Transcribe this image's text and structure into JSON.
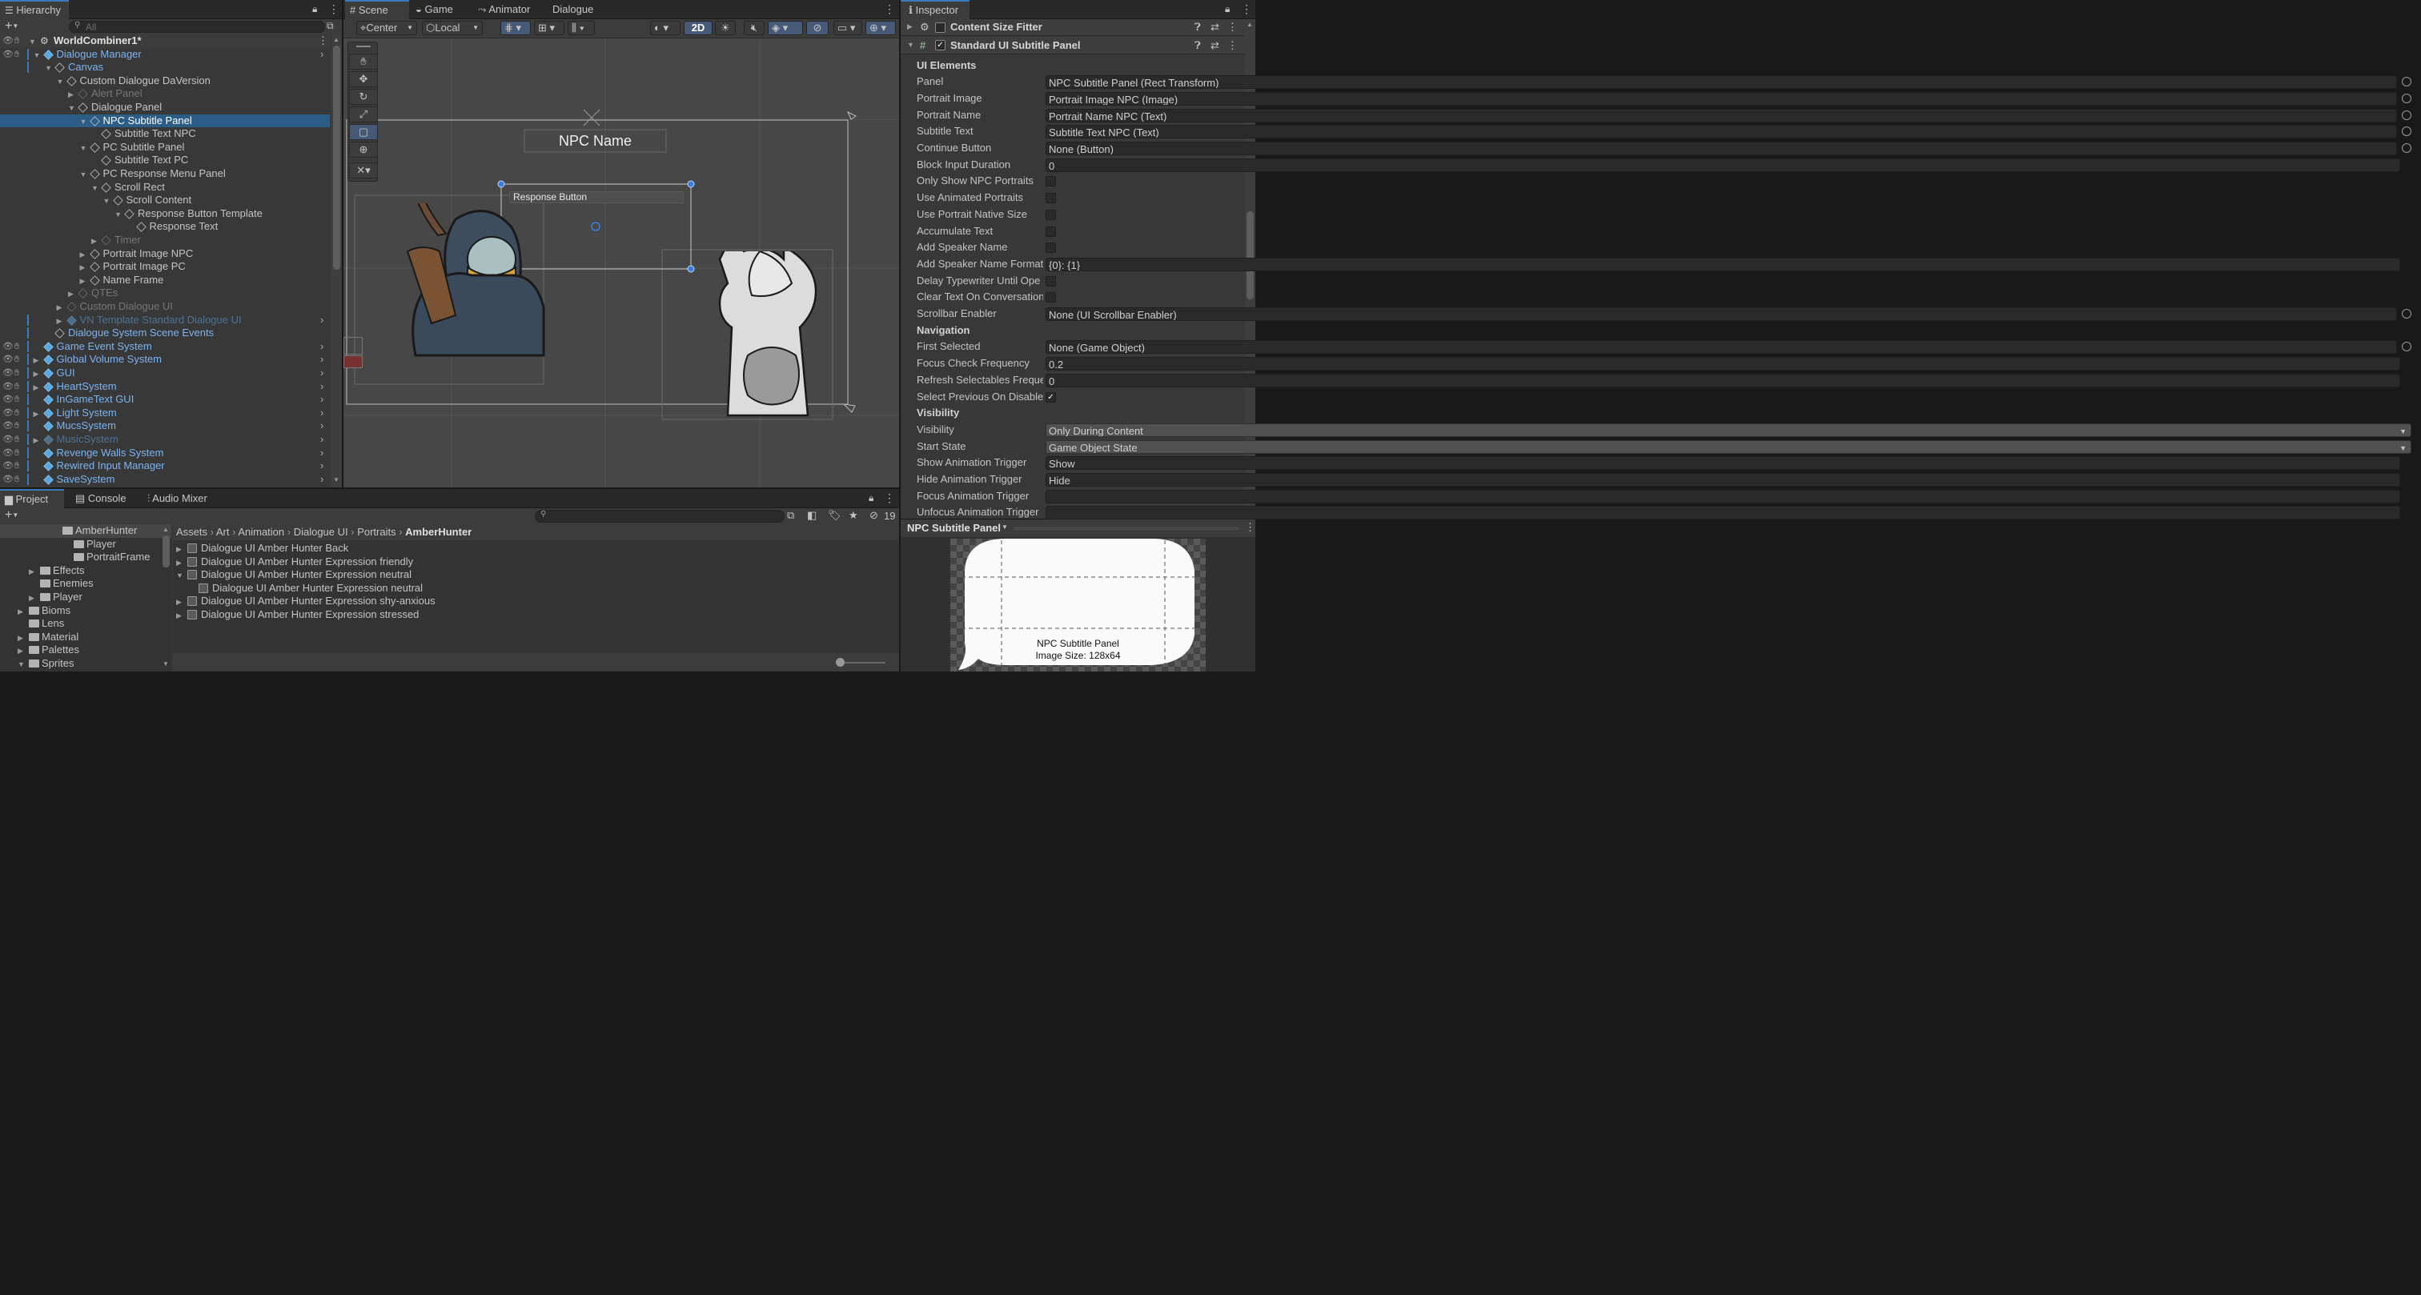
{
  "hierarchy": {
    "tab": "Hierarchy",
    "search_placeholder": "All",
    "root": "WorldCombiner1*",
    "items": [
      {
        "label": "Dialogue Manager",
        "indent": 1,
        "style": "blue",
        "icon": "blue",
        "expanded": true
      },
      {
        "label": "Canvas",
        "indent": 2,
        "style": "blue",
        "icon": "normal",
        "expanded": true
      },
      {
        "label": "Custom Dialogue DaVersion",
        "indent": 3,
        "style": "normal",
        "icon": "normal",
        "expanded": true
      },
      {
        "label": "Alert Panel",
        "indent": 4,
        "style": "dim",
        "icon": "dim",
        "expanded": false
      },
      {
        "label": "Dialogue Panel",
        "indent": 4,
        "style": "normal",
        "icon": "normal",
        "expanded": true
      },
      {
        "label": "NPC Subtitle Panel",
        "indent": 5,
        "style": "normal",
        "icon": "normal",
        "expanded": true,
        "selected": true
      },
      {
        "label": "Subtitle Text NPC",
        "indent": 6,
        "style": "normal",
        "icon": "normal"
      },
      {
        "label": "PC Subtitle Panel",
        "indent": 5,
        "style": "normal",
        "icon": "normal",
        "expanded": true
      },
      {
        "label": "Subtitle Text PC",
        "indent": 6,
        "style": "normal",
        "icon": "normal"
      },
      {
        "label": "PC Response Menu Panel",
        "indent": 5,
        "style": "normal",
        "icon": "normal",
        "expanded": true
      },
      {
        "label": "Scroll Rect",
        "indent": 6,
        "style": "normal",
        "icon": "normal",
        "expanded": true
      },
      {
        "label": "Scroll Content",
        "indent": 7,
        "style": "normal",
        "icon": "normal",
        "expanded": true
      },
      {
        "label": "Response Button Template",
        "indent": 8,
        "style": "normal",
        "icon": "normal",
        "expanded": true
      },
      {
        "label": "Response Text",
        "indent": 9,
        "style": "normal",
        "icon": "normal"
      },
      {
        "label": "Timer",
        "indent": 6,
        "style": "dim",
        "icon": "dim",
        "expanded": false
      },
      {
        "label": "Portrait Image NPC",
        "indent": 5,
        "style": "normal",
        "icon": "normal",
        "expanded": false
      },
      {
        "label": "Portrait Image PC",
        "indent": 5,
        "style": "normal",
        "icon": "normal",
        "expanded": false
      },
      {
        "label": "Name Frame",
        "indent": 5,
        "style": "normal",
        "icon": "normal",
        "expanded": false
      },
      {
        "label": "QTEs",
        "indent": 4,
        "style": "dim",
        "icon": "dim",
        "expanded": false
      },
      {
        "label": "Custom Dialogue UI",
        "indent": 3,
        "style": "dim",
        "icon": "dim",
        "expanded": false
      },
      {
        "label": "VN Template Standard Dialogue UI",
        "indent": 3,
        "style": "dimblue",
        "icon": "dimblue",
        "expanded": false
      },
      {
        "label": "Dialogue System Scene Events",
        "indent": 2,
        "style": "blue",
        "icon": "normal"
      },
      {
        "label": "Game Event System",
        "indent": 1,
        "style": "blue",
        "icon": "blue"
      },
      {
        "label": "Global Volume System",
        "indent": 1,
        "style": "blue",
        "icon": "blue",
        "expanded": false
      },
      {
        "label": "GUI",
        "indent": 1,
        "style": "blue",
        "icon": "blue",
        "expanded": false
      },
      {
        "label": "HeartSystem",
        "indent": 1,
        "style": "blue",
        "icon": "blue",
        "expanded": false
      },
      {
        "label": "InGameText GUI",
        "indent": 1,
        "style": "blue",
        "icon": "blue"
      },
      {
        "label": "Light System",
        "indent": 1,
        "style": "blue",
        "icon": "blue",
        "expanded": false
      },
      {
        "label": "MucsSystem",
        "indent": 1,
        "style": "blue",
        "icon": "blue"
      },
      {
        "label": "MusicSystem",
        "indent": 1,
        "style": "dimblue",
        "icon": "dimblue",
        "expanded": false
      },
      {
        "label": "Revenge Walls System",
        "indent": 1,
        "style": "blue",
        "icon": "blue"
      },
      {
        "label": "Rewired Input Manager",
        "indent": 1,
        "style": "blue",
        "icon": "blue"
      },
      {
        "label": "SaveSystem",
        "indent": 1,
        "style": "blue",
        "icon": "blue"
      }
    ]
  },
  "scene": {
    "tabs": [
      "Scene",
      "Game",
      "Animator",
      "Dialogue"
    ],
    "pivot": "Center",
    "space": "Local",
    "mode_2d": "2D",
    "npc_name": "NPC Name",
    "response_button": "Response Button"
  },
  "inspector": {
    "tab": "Inspector",
    "component1": "Content Size Fitter",
    "component2": "Standard UI Subtitle Panel",
    "rows": [
      {
        "type": "section",
        "label": "UI Elements"
      },
      {
        "type": "ref",
        "label": "Panel",
        "value": "NPC Subtitle Panel (Rect Transform)"
      },
      {
        "type": "ref",
        "label": "Portrait Image",
        "value": "Portrait Image NPC (Image)"
      },
      {
        "type": "ref",
        "label": "Portrait Name",
        "value": "Portrait Name NPC (Text)"
      },
      {
        "type": "ref",
        "label": "Subtitle Text",
        "value": "Subtitle Text NPC (Text)"
      },
      {
        "type": "ref",
        "label": "Continue Button",
        "value": "None (Button)"
      },
      {
        "type": "field",
        "label": "Block Input Duration",
        "value": "0"
      },
      {
        "type": "check",
        "label": "Only Show NPC Portraits",
        "checked": false
      },
      {
        "type": "check",
        "label": "Use Animated Portraits",
        "checked": false
      },
      {
        "type": "check",
        "label": "Use Portrait Native Size",
        "checked": false
      },
      {
        "type": "check",
        "label": "Accumulate Text",
        "checked": false
      },
      {
        "type": "check",
        "label": "Add Speaker Name",
        "checked": false
      },
      {
        "type": "field",
        "label": "Add Speaker Name Format",
        "value": "{0}: {1}"
      },
      {
        "type": "check",
        "label": "Delay Typewriter Until Ope",
        "checked": false
      },
      {
        "type": "check",
        "label": "Clear Text On Conversation",
        "checked": false
      },
      {
        "type": "ref",
        "label": "Scrollbar Enabler",
        "value": "None (UI Scrollbar Enabler)"
      },
      {
        "type": "section",
        "label": "Navigation"
      },
      {
        "type": "ref",
        "label": "First Selected",
        "value": "None (Game Object)"
      },
      {
        "type": "field",
        "label": "Focus Check Frequency",
        "value": "0.2"
      },
      {
        "type": "field",
        "label": "Refresh Selectables Freque",
        "value": "0"
      },
      {
        "type": "check",
        "label": "Select Previous On Disable",
        "checked": true
      },
      {
        "type": "section",
        "label": "Visibility"
      },
      {
        "type": "dropdown",
        "label": "Visibility",
        "value": "Only During Content"
      },
      {
        "type": "dropdown",
        "label": "Start State",
        "value": "Game Object State"
      },
      {
        "type": "field",
        "label": "Show Animation Trigger",
        "value": "Show"
      },
      {
        "type": "field",
        "label": "Hide Animation Trigger",
        "value": "Hide"
      },
      {
        "type": "field",
        "label": "Focus Animation Trigger",
        "value": ""
      },
      {
        "type": "field",
        "label": "Unfocus Animation Trigger",
        "value": ""
      }
    ],
    "preview_title": "NPC Subtitle Panel",
    "preview_caption1": "NPC Subtitle Panel",
    "preview_caption2": "Image Size: 128x64"
  },
  "project": {
    "tabs": [
      "Project",
      "Console",
      "Audio Mixer"
    ],
    "hidden_count": "19",
    "breadcrumb": [
      "Assets",
      "Art",
      "Animation",
      "Dialogue UI",
      "Portraits",
      "AmberHunter"
    ],
    "folders": [
      {
        "label": "AmberHunter",
        "indent": 5,
        "arrow": false,
        "selected": true
      },
      {
        "label": "Player",
        "indent": 6,
        "arrow": false
      },
      {
        "label": "PortraitFrame",
        "indent": 6,
        "arrow": false
      },
      {
        "label": "Effects",
        "indent": 3,
        "arrow": true
      },
      {
        "label": "Enemies",
        "indent": 3,
        "arrow": false
      },
      {
        "label": "Player",
        "indent": 3,
        "arrow": true
      },
      {
        "label": "Bioms",
        "indent": 2,
        "arrow": true
      },
      {
        "label": "Lens",
        "indent": 2,
        "arrow": false
      },
      {
        "label": "Material",
        "indent": 2,
        "arrow": true
      },
      {
        "label": "Palettes",
        "indent": 2,
        "arrow": true
      },
      {
        "label": "Sprites",
        "indent": 2,
        "arrow": true,
        "open": true
      }
    ],
    "assets": [
      {
        "label": "Dialogue UI Amber Hunter Back",
        "indent": 0,
        "expanded": false
      },
      {
        "label": "Dialogue UI Amber Hunter Expression friendly",
        "indent": 0,
        "expanded": false
      },
      {
        "label": "Dialogue UI Amber Hunter Expression neutral",
        "indent": 0,
        "expanded": true
      },
      {
        "label": "Dialogue UI Amber Hunter Expression neutral",
        "indent": 1,
        "sub": true
      },
      {
        "label": "Dialogue UI Amber Hunter Expression shy-anxious",
        "indent": 0,
        "expanded": false
      },
      {
        "label": "Dialogue UI Amber Hunter Expression stressed",
        "indent": 0,
        "expanded": false
      }
    ]
  }
}
